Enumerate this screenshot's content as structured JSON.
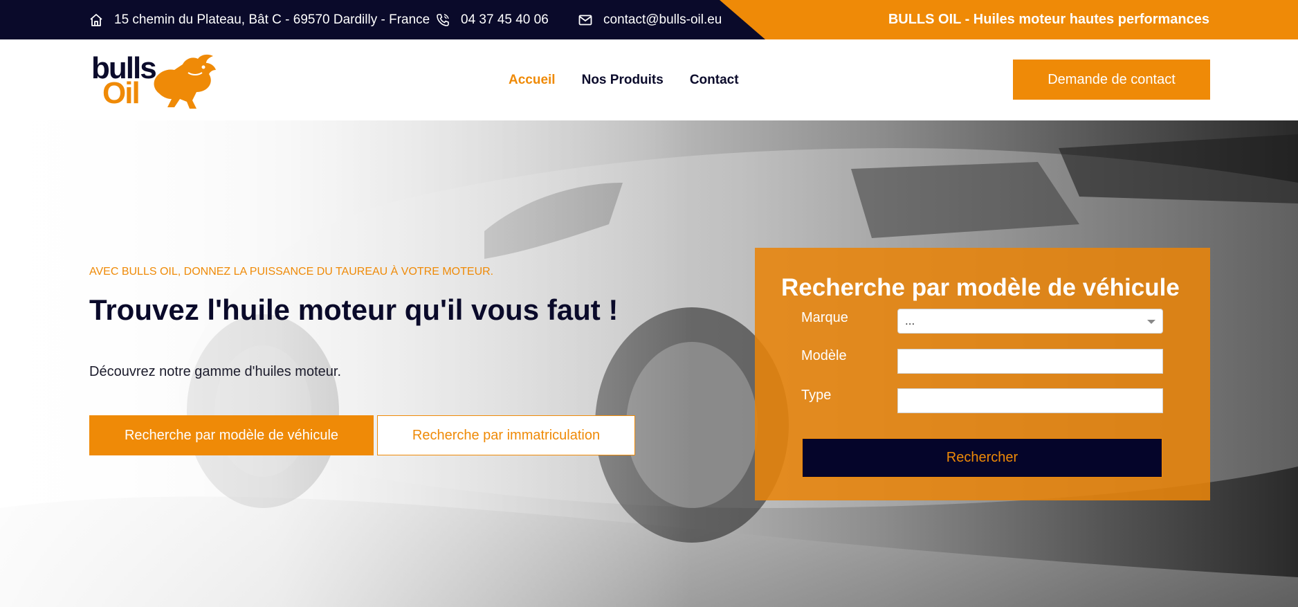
{
  "topbar": {
    "address": "15 chemin du Plateau, Bât C - 69570 Dardilly - France",
    "phone": "04 37 45 40 06",
    "email": "contact@bulls-oil.eu",
    "tagline": "BULLS OIL - Huiles moteur hautes performances"
  },
  "header": {
    "logo_line1": "bulls",
    "logo_line2": "Oil",
    "nav": [
      {
        "label": "Accueil",
        "active": true
      },
      {
        "label": "Nos Produits",
        "active": false
      },
      {
        "label": "Contact",
        "active": false
      }
    ],
    "contact_button": "Demande de contact"
  },
  "hero": {
    "kicker": "AVEC BULLS OIL, DONNEZ LA PUISSANCE DU TAUREAU À VOTRE MOTEUR.",
    "headline": "Trouvez l'huile moteur qu'il vous faut !",
    "subline": "Découvrez notre gamme d'huiles moteur.",
    "button_model": "Recherche par modèle de véhicule",
    "button_immat": "Recherche par immatriculation"
  },
  "search_panel": {
    "title": "Recherche par modèle de véhicule",
    "marque_label": "Marque",
    "marque_value": "...",
    "modele_label": "Modèle",
    "modele_value": "",
    "type_label": "Type",
    "type_value": "",
    "submit": "Rechercher"
  },
  "colors": {
    "accent": "#ef8a07",
    "navy": "#0a0a2a"
  }
}
